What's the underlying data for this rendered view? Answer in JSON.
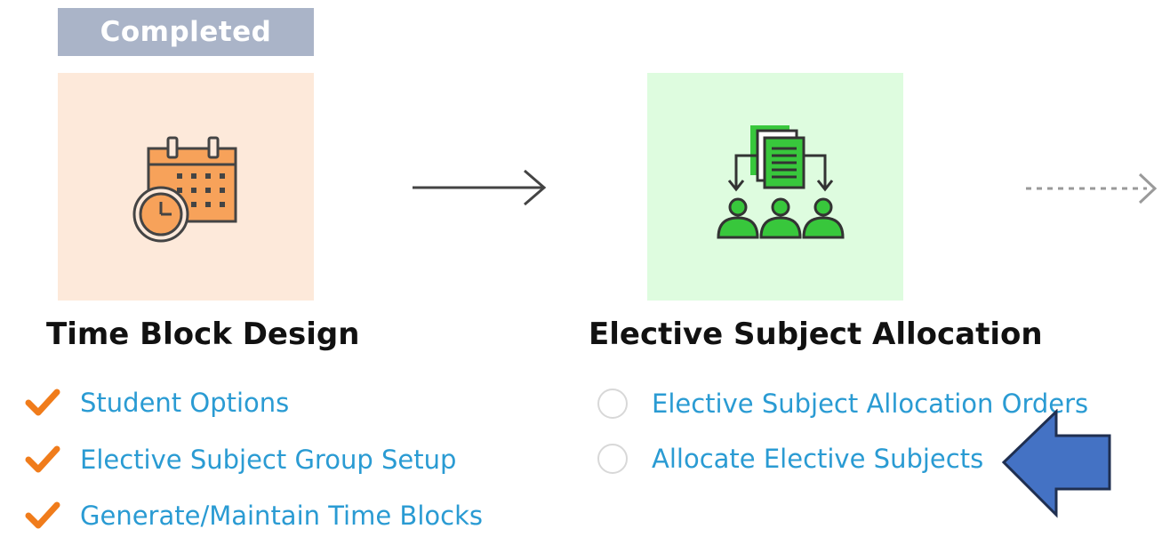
{
  "badge": {
    "label": "Completed"
  },
  "colors": {
    "badge_bg": "#aab4c8",
    "tile_time_block_bg": "#fde9da",
    "tile_elective_bg": "#defcdf",
    "link": "#2a9bd3",
    "check": "#f07c1b",
    "annotation_arrow": "#4472c4"
  },
  "steps": [
    {
      "title": "Time Block Design",
      "icon": "calendar-clock-icon",
      "tasks": [
        {
          "label": "Student Options",
          "status": "done"
        },
        {
          "label": "Elective Subject Group Setup",
          "status": "done"
        },
        {
          "label": "Generate/Maintain Time Blocks",
          "status": "done"
        }
      ]
    },
    {
      "title": "Elective Subject Allocation",
      "icon": "document-distribution-icon",
      "tasks": [
        {
          "label": "Elective Subject Allocation Orders",
          "status": "pending"
        },
        {
          "label": "Allocate Elective Subjects",
          "status": "pending"
        }
      ]
    }
  ],
  "connectors": [
    "arrow-right-icon",
    "dotted-arrow-right-icon"
  ],
  "annotation": {
    "icon": "blue-pointer-arrow-icon"
  }
}
